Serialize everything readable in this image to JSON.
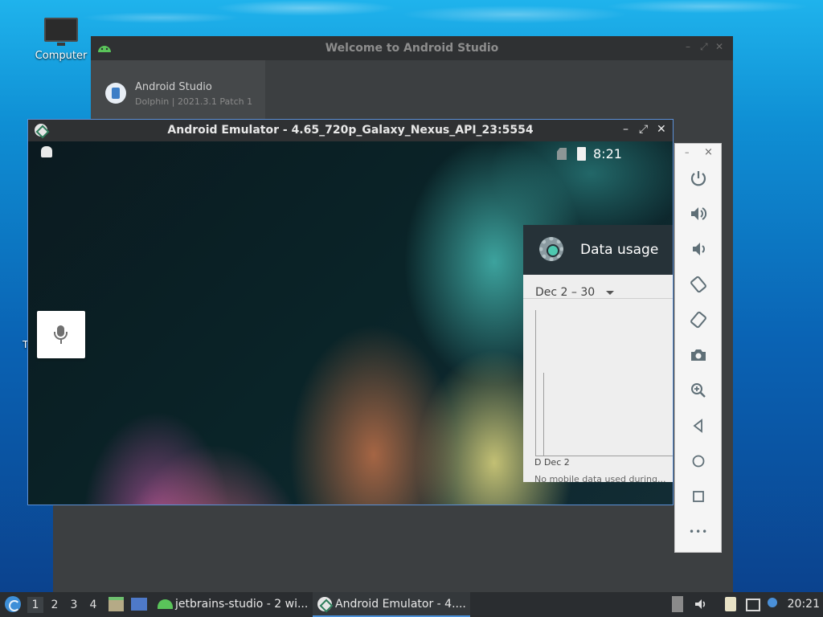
{
  "desktop": {
    "computer_icon_label": "Computer",
    "partial_icon_label": "T"
  },
  "welcome_window": {
    "title": "Welcome to Android Studio",
    "app_name": "Android Studio",
    "app_version": "Dolphin | 2021.3.1 Patch 1"
  },
  "emulator_window": {
    "title": "Android Emulator - 4.65_720p_Galaxy_Nexus_API_23:5554",
    "minimize": "–",
    "maximize": "⤢",
    "close": "✕",
    "status_bar": {
      "time": "8:21"
    },
    "data_usage": {
      "title": "Data usage",
      "date_range": "Dec 2 – 30",
      "x_labels": "D Dec 2",
      "note": "No mobile data used during..."
    }
  },
  "side_toolbar": {
    "minimize": "–",
    "close": "×",
    "buttons": [
      "power",
      "volume-up",
      "volume-down",
      "rotate-left",
      "rotate-right",
      "screenshot",
      "zoom",
      "back",
      "home",
      "overview",
      "more"
    ],
    "more_label": "•••"
  },
  "taskbar": {
    "workspaces": [
      "1",
      "2",
      "3",
      "4"
    ],
    "tasks": [
      {
        "label": "jetbrains-studio - 2 wi..."
      },
      {
        "label": "Android Emulator - 4...."
      }
    ],
    "clock": "20:21"
  }
}
